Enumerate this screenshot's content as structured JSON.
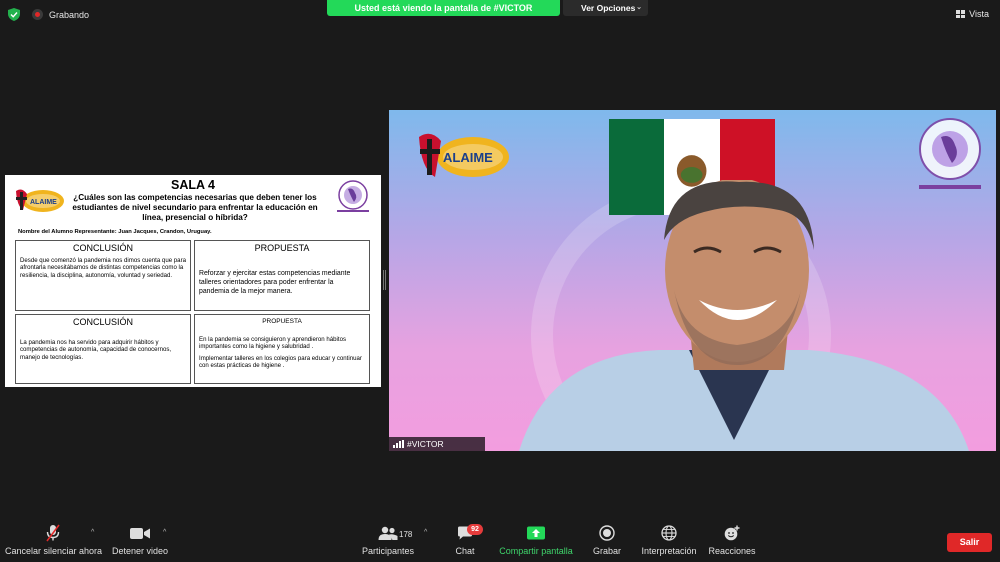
{
  "top_bar": {
    "recording_label": "Grabando",
    "share_banner": "Usted está viendo la pantalla de #VICTOR",
    "view_options_label": "Ver Opciones",
    "view_label": "Vista"
  },
  "document": {
    "title": "SALA 4",
    "question": "¿Cuáles son las competencias necesarias que deben tener los estudiantes de nivel secundario para enfrentar la educación en línea, presencial o híbrida?",
    "student_line": "Nombre del Alumno Representante: Juan Jacques, Crandon, Uruguay.",
    "logo_text": "ALAIME",
    "boxes": [
      {
        "title": "CONCLUSIÓN",
        "text": "Desde que comenzó la pandemia nos dimos cuenta que para afrontarla necesitábamos de distintas competencias como la resiliencia, la disciplina, autonomía, voluntad y  seriedad."
      },
      {
        "title": "PROPUESTA",
        "text": "Reforzar y ejercitar estas competencias mediante talleres orientadores para poder enfrentar la pandemia de la mejor manera."
      },
      {
        "title": "CONCLUSIÓN",
        "text": "La pandemia nos ha servido para adquirir hábitos y competencias de autonomía, capacidad de conocernos, manejo de tecnologías."
      },
      {
        "title": "PROPUESTA",
        "text_1": "En la pandemia se consiguieron y aprendieron hábitos importantes como la higiene y salubridad .",
        "text_2": "Implementar talleres en los colegios  para educar y continuar con estas prácticas de higiene ."
      }
    ]
  },
  "video": {
    "participant_name": "#VICTOR",
    "logo_text": "ALAIME",
    "flag_colors": [
      "#0a6b3a",
      "#ffffff",
      "#ce1126"
    ]
  },
  "toolbar": {
    "unmute_label": "Cancelar silenciar ahora",
    "stop_video_label": "Detener video",
    "participants_label": "Participantes",
    "participants_count": "178",
    "chat_label": "Chat",
    "chat_badge": "92",
    "share_label": "Compartir pantalla",
    "record_label": "Grabar",
    "interpretation_label": "Interpretación",
    "reactions_label": "Reacciones",
    "leave_label": "Salir"
  },
  "colors": {
    "background": "#1a1a1a",
    "share_green": "#23d959",
    "leave_red": "#e02828",
    "badge_red": "#e53b3b"
  }
}
